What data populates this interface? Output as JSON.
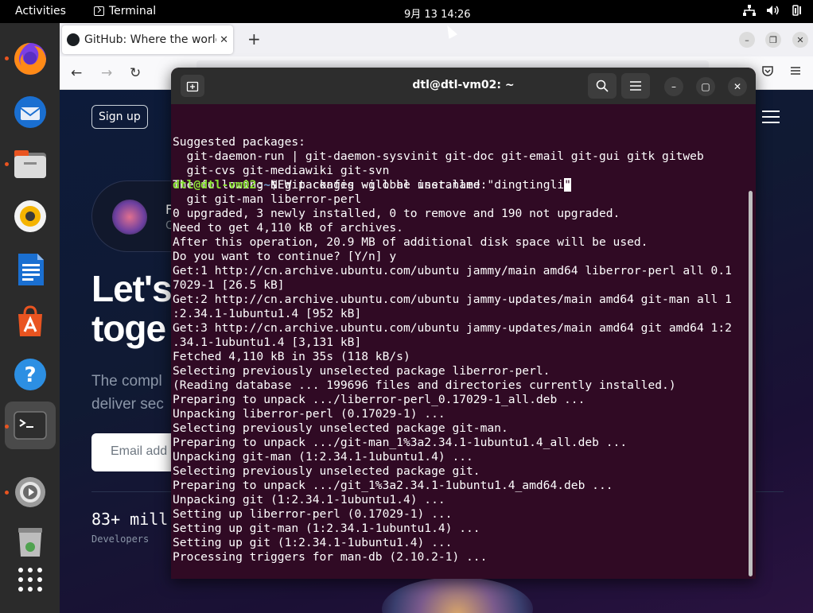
{
  "topbar": {
    "activities": "Activities",
    "app_name": "Terminal",
    "clock": "9月 13  14:26"
  },
  "dock": {
    "items": [
      "firefox",
      "thunderbird",
      "files",
      "rhythmbox",
      "libreoffice-writer",
      "app-center",
      "help",
      "terminal",
      "software-updater",
      "trash",
      "show-apps"
    ]
  },
  "browser": {
    "tab_title": "GitHub: Where the world",
    "tab_close": "✕",
    "new_tab": "+",
    "back": "←",
    "forward": "→",
    "reload": "↻"
  },
  "github": {
    "signup": "Sign up",
    "promo_line1": "F",
    "promo_line2": "C",
    "hero_line1": "Let's",
    "hero_line2": "toge",
    "sub_line1": "The compl",
    "sub_line2": "deliver sec",
    "email_placeholder": "Email add",
    "stat_value": "83+ mill",
    "stat_label": "Developers"
  },
  "terminal": {
    "title": "dtl@dtl-vm02: ~",
    "lines": [
      "Suggested packages:",
      "  git-daemon-run | git-daemon-sysvinit git-doc git-email git-gui gitk gitweb",
      "  git-cvs git-mediawiki git-svn",
      "The following NEW packages will be installed:",
      "  git git-man liberror-perl",
      "0 upgraded, 3 newly installed, 0 to remove and 190 not upgraded.",
      "Need to get 4,110 kB of archives.",
      "After this operation, 20.9 MB of additional disk space will be used.",
      "Do you want to continue? [Y/n] y",
      "Get:1 http://cn.archive.ubuntu.com/ubuntu jammy/main amd64 liberror-perl all 0.1",
      "7029-1 [26.5 kB]",
      "Get:2 http://cn.archive.ubuntu.com/ubuntu jammy-updates/main amd64 git-man all 1",
      ":2.34.1-1ubuntu1.4 [952 kB]",
      "Get:3 http://cn.archive.ubuntu.com/ubuntu jammy-updates/main amd64 git amd64 1:2",
      ".34.1-1ubuntu1.4 [3,131 kB]",
      "Fetched 4,110 kB in 35s (118 kB/s)",
      "Selecting previously unselected package liberror-perl.",
      "(Reading database ... 199696 files and directories currently installed.)",
      "Preparing to unpack .../liberror-perl_0.17029-1_all.deb ...",
      "Unpacking liberror-perl (0.17029-1) ...",
      "Selecting previously unselected package git-man.",
      "Preparing to unpack .../git-man_1%3a2.34.1-1ubuntu1.4_all.deb ...",
      "Unpacking git-man (1:2.34.1-1ubuntu1.4) ...",
      "Selecting previously unselected package git.",
      "Preparing to unpack .../git_1%3a2.34.1-1ubuntu1.4_amd64.deb ...",
      "Unpacking git (1:2.34.1-1ubuntu1.4) ...",
      "Setting up liberror-perl (0.17029-1) ...",
      "Setting up git-man (1:2.34.1-1ubuntu1.4) ...",
      "Setting up git (1:2.34.1-1ubuntu1.4) ...",
      "Processing triggers for man-db (2.10.2-1) ..."
    ],
    "prompt_user": "dtl@dtl-vm02",
    "prompt_sep": ":",
    "prompt_path": "~",
    "prompt_dollar": "$ ",
    "command": "git config -global user.name \"dingtingli",
    "cursor_char": "\""
  }
}
